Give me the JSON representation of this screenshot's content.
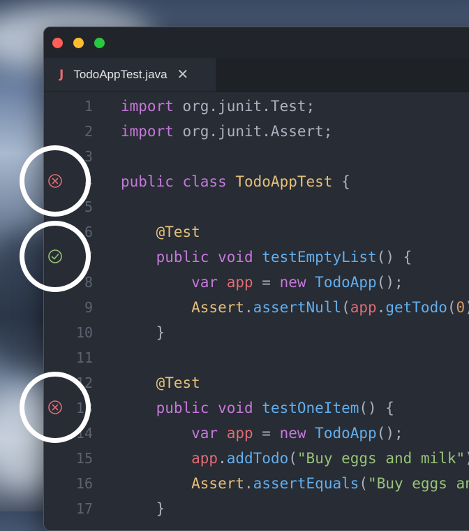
{
  "window": {
    "traffic_lights": [
      {
        "name": "close-button",
        "color": "#ff5f57"
      },
      {
        "name": "minimize-button",
        "color": "#febc2e"
      },
      {
        "name": "maximize-button",
        "color": "#28c840"
      }
    ]
  },
  "tab": {
    "icon_letter": "J",
    "filename": "TodoAppTest.java",
    "close_glyph": "✕"
  },
  "lines": [
    {
      "n": "1",
      "tokens": [
        [
          "kw",
          "import"
        ],
        [
          "pun",
          " org.junit.Test;"
        ]
      ]
    },
    {
      "n": "2",
      "tokens": [
        [
          "kw",
          "import"
        ],
        [
          "pun",
          " org.junit.Assert;"
        ]
      ]
    },
    {
      "n": "3",
      "tokens": []
    },
    {
      "n": "4",
      "tokens": [
        [
          "kw",
          "public class "
        ],
        [
          "cls",
          "TodoAppTest"
        ],
        [
          "pun",
          " {"
        ]
      ]
    },
    {
      "n": "5",
      "tokens": []
    },
    {
      "n": "6",
      "tokens": [
        [
          "cls",
          "    @Test"
        ]
      ]
    },
    {
      "n": "7",
      "tokens": [
        [
          "kw",
          "    public void "
        ],
        [
          "fn",
          "testEmptyList"
        ],
        [
          "pun",
          "() {"
        ]
      ]
    },
    {
      "n": "8",
      "tokens": [
        [
          "kw",
          "        var "
        ],
        [
          "var",
          "app"
        ],
        [
          "pun",
          " = "
        ],
        [
          "kw",
          "new "
        ],
        [
          "fn",
          "TodoApp"
        ],
        [
          "pun",
          "();"
        ]
      ]
    },
    {
      "n": "9",
      "tokens": [
        [
          "cls",
          "        Assert"
        ],
        [
          "pun",
          "."
        ],
        [
          "fn",
          "assertNull"
        ],
        [
          "pun",
          "("
        ],
        [
          "var",
          "app"
        ],
        [
          "pun",
          "."
        ],
        [
          "fn",
          "getTodo"
        ],
        [
          "pun",
          "("
        ],
        [
          "num",
          "0"
        ],
        [
          "pun",
          "));"
        ]
      ]
    },
    {
      "n": "10",
      "tokens": [
        [
          "pun",
          "    }"
        ]
      ]
    },
    {
      "n": "11",
      "tokens": []
    },
    {
      "n": "12",
      "tokens": [
        [
          "cls",
          "    @Test"
        ]
      ]
    },
    {
      "n": "13",
      "tokens": [
        [
          "kw",
          "    public void "
        ],
        [
          "fn",
          "testOneItem"
        ],
        [
          "pun",
          "() {"
        ]
      ]
    },
    {
      "n": "14",
      "tokens": [
        [
          "kw",
          "        var "
        ],
        [
          "var",
          "app"
        ],
        [
          "pun",
          " = "
        ],
        [
          "kw",
          "new "
        ],
        [
          "fn",
          "TodoApp"
        ],
        [
          "pun",
          "();"
        ]
      ]
    },
    {
      "n": "15",
      "tokens": [
        [
          "var",
          "        app"
        ],
        [
          "pun",
          "."
        ],
        [
          "fn",
          "addTodo"
        ],
        [
          "pun",
          "("
        ],
        [
          "str",
          "\"Buy eggs and milk\""
        ],
        [
          "pun",
          ");"
        ]
      ]
    },
    {
      "n": "16",
      "tokens": [
        [
          "cls",
          "        Assert"
        ],
        [
          "pun",
          "."
        ],
        [
          "fn",
          "assertEquals"
        ],
        [
          "pun",
          "("
        ],
        [
          "str",
          "\"Buy eggs and"
        ]
      ]
    },
    {
      "n": "17",
      "tokens": [
        [
          "pun",
          "    }"
        ]
      ]
    }
  ],
  "test_markers": [
    {
      "line": "4",
      "status": "failed",
      "icon": "x-circle-icon",
      "color": "#e06c75"
    },
    {
      "line": "7",
      "status": "passed",
      "icon": "check-circle-icon",
      "color": "#98c379"
    },
    {
      "line": "13",
      "status": "failed",
      "icon": "x-circle-icon",
      "color": "#e06c75"
    }
  ]
}
